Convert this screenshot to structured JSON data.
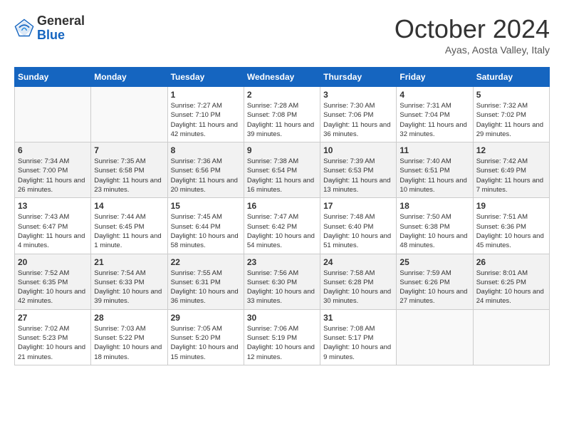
{
  "header": {
    "logo_general": "General",
    "logo_blue": "Blue",
    "month_title": "October 2024",
    "subtitle": "Ayas, Aosta Valley, Italy"
  },
  "days_of_week": [
    "Sunday",
    "Monday",
    "Tuesday",
    "Wednesday",
    "Thursday",
    "Friday",
    "Saturday"
  ],
  "weeks": [
    [
      {
        "day": "",
        "sunrise": "",
        "sunset": "",
        "daylight": ""
      },
      {
        "day": "",
        "sunrise": "",
        "sunset": "",
        "daylight": ""
      },
      {
        "day": "1",
        "sunrise": "Sunrise: 7:27 AM",
        "sunset": "Sunset: 7:10 PM",
        "daylight": "Daylight: 11 hours and 42 minutes."
      },
      {
        "day": "2",
        "sunrise": "Sunrise: 7:28 AM",
        "sunset": "Sunset: 7:08 PM",
        "daylight": "Daylight: 11 hours and 39 minutes."
      },
      {
        "day": "3",
        "sunrise": "Sunrise: 7:30 AM",
        "sunset": "Sunset: 7:06 PM",
        "daylight": "Daylight: 11 hours and 36 minutes."
      },
      {
        "day": "4",
        "sunrise": "Sunrise: 7:31 AM",
        "sunset": "Sunset: 7:04 PM",
        "daylight": "Daylight: 11 hours and 32 minutes."
      },
      {
        "day": "5",
        "sunrise": "Sunrise: 7:32 AM",
        "sunset": "Sunset: 7:02 PM",
        "daylight": "Daylight: 11 hours and 29 minutes."
      }
    ],
    [
      {
        "day": "6",
        "sunrise": "Sunrise: 7:34 AM",
        "sunset": "Sunset: 7:00 PM",
        "daylight": "Daylight: 11 hours and 26 minutes."
      },
      {
        "day": "7",
        "sunrise": "Sunrise: 7:35 AM",
        "sunset": "Sunset: 6:58 PM",
        "daylight": "Daylight: 11 hours and 23 minutes."
      },
      {
        "day": "8",
        "sunrise": "Sunrise: 7:36 AM",
        "sunset": "Sunset: 6:56 PM",
        "daylight": "Daylight: 11 hours and 20 minutes."
      },
      {
        "day": "9",
        "sunrise": "Sunrise: 7:38 AM",
        "sunset": "Sunset: 6:54 PM",
        "daylight": "Daylight: 11 hours and 16 minutes."
      },
      {
        "day": "10",
        "sunrise": "Sunrise: 7:39 AM",
        "sunset": "Sunset: 6:53 PM",
        "daylight": "Daylight: 11 hours and 13 minutes."
      },
      {
        "day": "11",
        "sunrise": "Sunrise: 7:40 AM",
        "sunset": "Sunset: 6:51 PM",
        "daylight": "Daylight: 11 hours and 10 minutes."
      },
      {
        "day": "12",
        "sunrise": "Sunrise: 7:42 AM",
        "sunset": "Sunset: 6:49 PM",
        "daylight": "Daylight: 11 hours and 7 minutes."
      }
    ],
    [
      {
        "day": "13",
        "sunrise": "Sunrise: 7:43 AM",
        "sunset": "Sunset: 6:47 PM",
        "daylight": "Daylight: 11 hours and 4 minutes."
      },
      {
        "day": "14",
        "sunrise": "Sunrise: 7:44 AM",
        "sunset": "Sunset: 6:45 PM",
        "daylight": "Daylight: 11 hours and 1 minute."
      },
      {
        "day": "15",
        "sunrise": "Sunrise: 7:45 AM",
        "sunset": "Sunset: 6:44 PM",
        "daylight": "Daylight: 10 hours and 58 minutes."
      },
      {
        "day": "16",
        "sunrise": "Sunrise: 7:47 AM",
        "sunset": "Sunset: 6:42 PM",
        "daylight": "Daylight: 10 hours and 54 minutes."
      },
      {
        "day": "17",
        "sunrise": "Sunrise: 7:48 AM",
        "sunset": "Sunset: 6:40 PM",
        "daylight": "Daylight: 10 hours and 51 minutes."
      },
      {
        "day": "18",
        "sunrise": "Sunrise: 7:50 AM",
        "sunset": "Sunset: 6:38 PM",
        "daylight": "Daylight: 10 hours and 48 minutes."
      },
      {
        "day": "19",
        "sunrise": "Sunrise: 7:51 AM",
        "sunset": "Sunset: 6:36 PM",
        "daylight": "Daylight: 10 hours and 45 minutes."
      }
    ],
    [
      {
        "day": "20",
        "sunrise": "Sunrise: 7:52 AM",
        "sunset": "Sunset: 6:35 PM",
        "daylight": "Daylight: 10 hours and 42 minutes."
      },
      {
        "day": "21",
        "sunrise": "Sunrise: 7:54 AM",
        "sunset": "Sunset: 6:33 PM",
        "daylight": "Daylight: 10 hours and 39 minutes."
      },
      {
        "day": "22",
        "sunrise": "Sunrise: 7:55 AM",
        "sunset": "Sunset: 6:31 PM",
        "daylight": "Daylight: 10 hours and 36 minutes."
      },
      {
        "day": "23",
        "sunrise": "Sunrise: 7:56 AM",
        "sunset": "Sunset: 6:30 PM",
        "daylight": "Daylight: 10 hours and 33 minutes."
      },
      {
        "day": "24",
        "sunrise": "Sunrise: 7:58 AM",
        "sunset": "Sunset: 6:28 PM",
        "daylight": "Daylight: 10 hours and 30 minutes."
      },
      {
        "day": "25",
        "sunrise": "Sunrise: 7:59 AM",
        "sunset": "Sunset: 6:26 PM",
        "daylight": "Daylight: 10 hours and 27 minutes."
      },
      {
        "day": "26",
        "sunrise": "Sunrise: 8:01 AM",
        "sunset": "Sunset: 6:25 PM",
        "daylight": "Daylight: 10 hours and 24 minutes."
      }
    ],
    [
      {
        "day": "27",
        "sunrise": "Sunrise: 7:02 AM",
        "sunset": "Sunset: 5:23 PM",
        "daylight": "Daylight: 10 hours and 21 minutes."
      },
      {
        "day": "28",
        "sunrise": "Sunrise: 7:03 AM",
        "sunset": "Sunset: 5:22 PM",
        "daylight": "Daylight: 10 hours and 18 minutes."
      },
      {
        "day": "29",
        "sunrise": "Sunrise: 7:05 AM",
        "sunset": "Sunset: 5:20 PM",
        "daylight": "Daylight: 10 hours and 15 minutes."
      },
      {
        "day": "30",
        "sunrise": "Sunrise: 7:06 AM",
        "sunset": "Sunset: 5:19 PM",
        "daylight": "Daylight: 10 hours and 12 minutes."
      },
      {
        "day": "31",
        "sunrise": "Sunrise: 7:08 AM",
        "sunset": "Sunset: 5:17 PM",
        "daylight": "Daylight: 10 hours and 9 minutes."
      },
      {
        "day": "",
        "sunrise": "",
        "sunset": "",
        "daylight": ""
      },
      {
        "day": "",
        "sunrise": "",
        "sunset": "",
        "daylight": ""
      }
    ]
  ]
}
